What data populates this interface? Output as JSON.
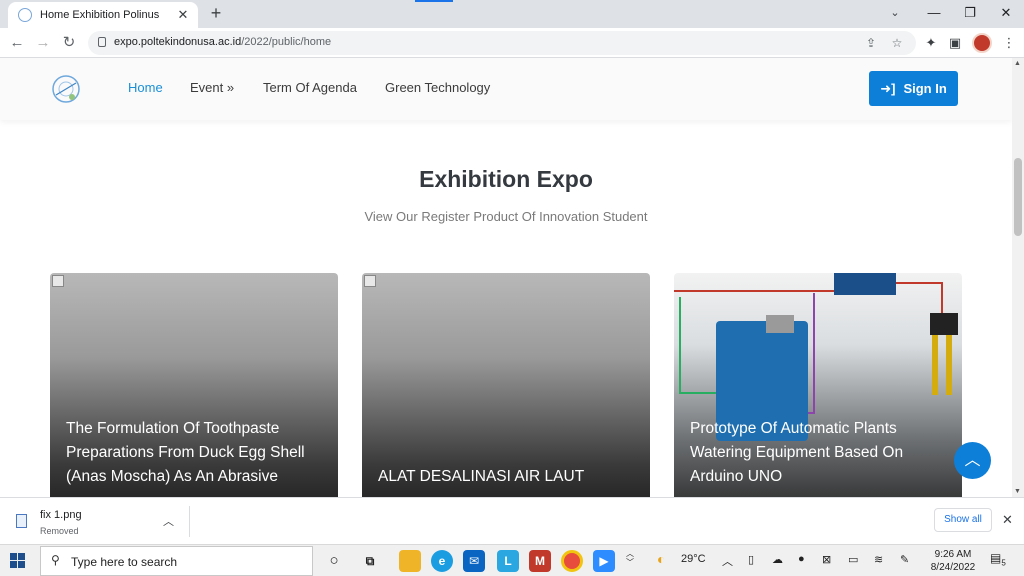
{
  "browser": {
    "tab_title": "Home Exhibition Polinus",
    "tab_close": "✕",
    "new_tab": "+",
    "url_host": "expo.poltekindonusa.ac.id",
    "url_path": "/2022/public/home"
  },
  "site": {
    "nav": {
      "home": "Home",
      "event": "Event »",
      "term": "Term Of Agenda",
      "green": "Green Technology",
      "signin": "Sign In"
    },
    "heading": "Exhibition Expo",
    "subheading": "View Our Register Product Of Innovation Student",
    "cards": [
      {
        "title": "The Formulation Of Toothpaste Preparations From Duck Egg Shell (Anas Moscha) As An Abrasive"
      },
      {
        "title": "ALAT DESALINASI AIR LAUT"
      },
      {
        "title": "Prototype Of Automatic Plants Watering Equipment Based On Arduino UNO"
      }
    ]
  },
  "download": {
    "filename": "fix 1.png",
    "status": "Removed",
    "show_all": "Show all"
  },
  "taskbar": {
    "search_placeholder": "Type here to search",
    "weather": "29°C",
    "time": "9:26 AM",
    "date": "8/24/2022",
    "notification_count": "5"
  },
  "colors": {
    "brand_blue": "#0d7fd8",
    "nav_active": "#1a8fd6"
  }
}
